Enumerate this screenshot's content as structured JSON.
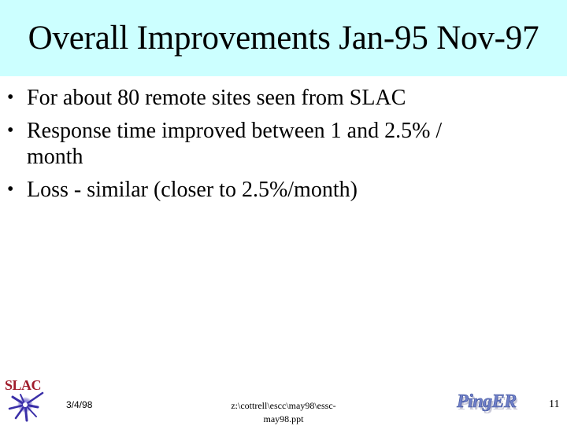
{
  "slide": {
    "title": "Overall Improvements Jan-95 Nov-97",
    "bullets": [
      {
        "glyph": "•",
        "text": "For about 80 remote sites seen from SLAC"
      },
      {
        "glyph": "•",
        "text": "Response time improved between 1 and 2.5% / month"
      },
      {
        "glyph": "•",
        "text": "Loss - similar (closer to 2.5%/month)"
      }
    ]
  },
  "footer": {
    "logo_left": {
      "icon": "slac-logo-icon",
      "text": "SLAC"
    },
    "date": "3/4/98",
    "path_line1": "z:\\cottrell\\escc\\may98\\essc-",
    "path_line2": "may98.ppt",
    "logo_right": {
      "icon": "pinger-logo-icon",
      "text": "PingER"
    },
    "page_number": "11"
  },
  "colors": {
    "title_band": "#ccffff",
    "slac_red": "#a01c2c",
    "slac_blue": "#3a2fa8",
    "pinger_blue": "#6f7fc8"
  }
}
